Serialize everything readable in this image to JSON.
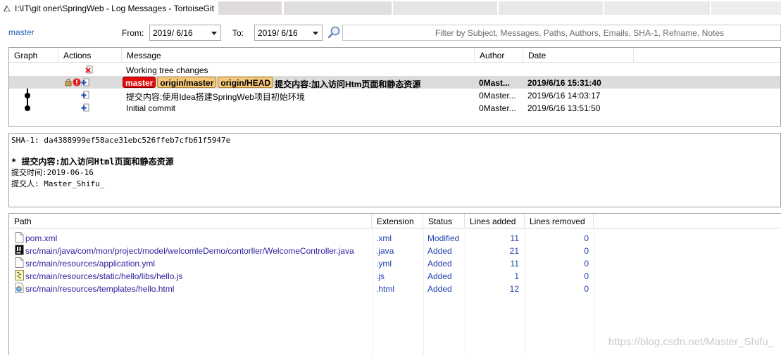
{
  "window": {
    "title": "I:\\IT\\git oner\\SpringWeb - Log Messages - TortoiseGit"
  },
  "toolbar": {
    "branch": "master",
    "from_label": "From:",
    "from_value": "2019/  6/16",
    "to_label": "To:",
    "to_value": "2019/  6/16",
    "filter_placeholder": "Filter by Subject, Messages, Paths, Authors, Emails, SHA-1, Refname, Notes"
  },
  "log": {
    "columns": [
      "Graph",
      "Actions",
      "Message",
      "Author",
      "Date"
    ],
    "rows": [
      {
        "message": "Working tree changes",
        "author": "",
        "date": "",
        "tags": []
      },
      {
        "message": "提交内容:加入访问Htm页面和静态资源",
        "author": "0Mast...",
        "date": "2019/6/16 15:31:40",
        "tags": [
          {
            "label": "master",
            "kind": "local"
          },
          {
            "label": "origin/master",
            "kind": "remote"
          },
          {
            "label": "origin/HEAD",
            "kind": "remote"
          }
        ]
      },
      {
        "message": "提交内容:使用Idea搭建SpringWeb项目初始环境",
        "author": "0Master...",
        "date": "2019/6/16 14:03:17",
        "tags": []
      },
      {
        "message": "Initial commit",
        "author": "0Master...",
        "date": "2019/6/16 13:51:50",
        "tags": []
      }
    ]
  },
  "commit_message": {
    "sha": "SHA-1: da4388999ef58ace31ebc526ffeb7cfb61f5947e",
    "subject": "* 提交内容:加入访问Html页面和静态资源",
    "line1": "提交时间:2019-06-16",
    "line2": "提交人: Master_Shifu_"
  },
  "files": {
    "columns": [
      "Path",
      "Extension",
      "Status",
      "Lines added",
      "Lines removed"
    ],
    "rows": [
      {
        "path": "pom.xml",
        "ext": ".xml",
        "status": "Modified",
        "added": "11",
        "removed": "0",
        "icon": "blank-file-icon"
      },
      {
        "path": "src/main/java/com/mon/project/model/welcomleDemo/contorller/WelcomeController.java",
        "ext": ".java",
        "status": "Added",
        "added": "21",
        "removed": "0",
        "icon": "intellij-file-icon"
      },
      {
        "path": "src/main/resources/application.yml",
        "ext": ".yml",
        "status": "Added",
        "added": "11",
        "removed": "0",
        "icon": "blank-file-icon"
      },
      {
        "path": "src/main/resources/static/hello/libs/hello.js",
        "ext": ".js",
        "status": "Added",
        "added": "1",
        "removed": "0",
        "icon": "script-file-icon"
      },
      {
        "path": "src/main/resources/templates/hello.html",
        "ext": ".html",
        "status": "Added",
        "added": "12",
        "removed": "0",
        "icon": "html-file-icon"
      }
    ]
  },
  "watermark": "https://blog.csdn.net/Master_Shifu_",
  "colors": {
    "link": "#1f5fb8",
    "local_tag": "#e30c0c",
    "remote_tag": "#f4c77a",
    "selected_row": "#dcdcdc"
  }
}
